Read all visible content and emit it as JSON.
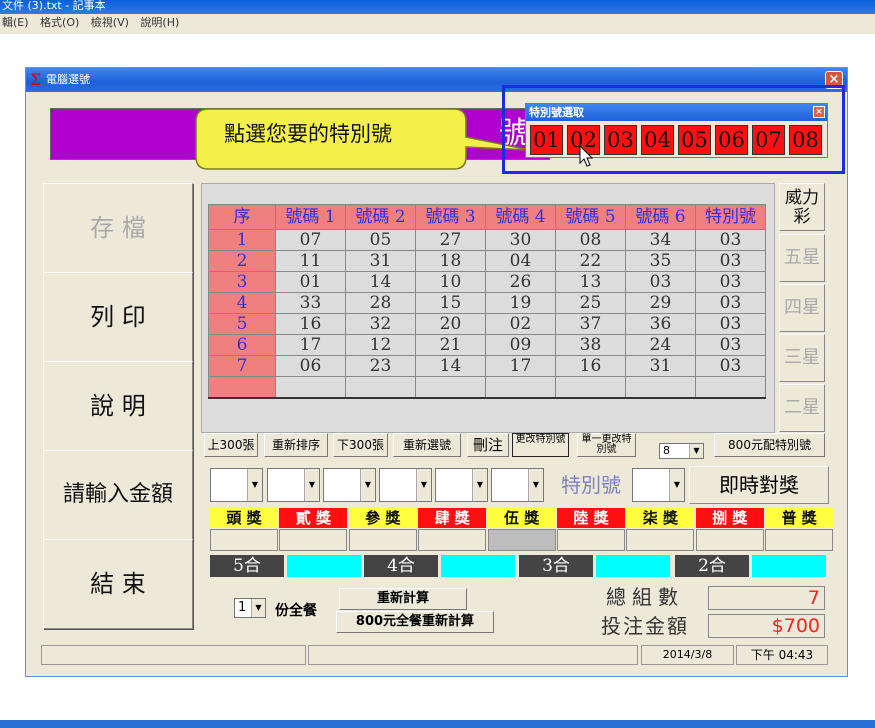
{
  "notepad": {
    "title": "文件 (3).txt - 記事本",
    "menu": [
      "輯(E)",
      "格式(O)",
      "檢視(V)",
      "說明(H)"
    ]
  },
  "dialog": {
    "title": "電腦選號",
    "close": "×",
    "banner_char": "號"
  },
  "left_buttons": {
    "save": "存 檔",
    "print": "列 印",
    "help": "說 明",
    "amount": "請輸入金額",
    "end": "結 束"
  },
  "table": {
    "headers": [
      "序",
      "號碼 1",
      "號碼 2",
      "號碼 3",
      "號碼 4",
      "號碼 5",
      "號碼 6",
      "特別號"
    ],
    "rows": [
      [
        "1",
        "07",
        "05",
        "27",
        "30",
        "08",
        "34",
        "03"
      ],
      [
        "2",
        "11",
        "31",
        "18",
        "04",
        "22",
        "35",
        "03"
      ],
      [
        "3",
        "01",
        "14",
        "10",
        "26",
        "13",
        "03",
        "03"
      ],
      [
        "4",
        "33",
        "28",
        "15",
        "19",
        "25",
        "29",
        "03"
      ],
      [
        "5",
        "16",
        "32",
        "20",
        "02",
        "37",
        "36",
        "03"
      ],
      [
        "6",
        "17",
        "12",
        "21",
        "09",
        "38",
        "24",
        "03"
      ],
      [
        "7",
        "06",
        "23",
        "14",
        "17",
        "16",
        "31",
        "03"
      ]
    ]
  },
  "types": {
    "power": "威力彩",
    "five": "五星",
    "four": "四星",
    "three": "三星",
    "two": "二星"
  },
  "toolbar": {
    "prev300": "上300張",
    "resort": "重新排序",
    "next300": "下300張",
    "reselect": "重新選號",
    "delete": "刪注",
    "change_special": "更改特別號",
    "single_change": "單一更改特別號",
    "count_select": "8",
    "special_800": "800元配特別號"
  },
  "entry": {
    "special_label": "特別號",
    "instant_button": "即時對獎"
  },
  "prizes": [
    {
      "label": "頭 獎",
      "style": "yellow"
    },
    {
      "label": "貳 獎",
      "style": "red"
    },
    {
      "label": "參 獎",
      "style": "yellow"
    },
    {
      "label": "肆 獎",
      "style": "red"
    },
    {
      "label": "伍 獎",
      "style": "yellow"
    },
    {
      "label": "陸 獎",
      "style": "red"
    },
    {
      "label": "柒 獎",
      "style": "yellow"
    },
    {
      "label": "捌 獎",
      "style": "red"
    },
    {
      "label": "普 獎",
      "style": "yellow"
    }
  ],
  "matches": [
    "5合",
    "4合",
    "3合",
    "2合"
  ],
  "bottom": {
    "package_count": "1",
    "package_label": "份全餐",
    "recalc": "重新計算",
    "recalc_800": "800元全餐重新計算",
    "total_label": "總組數",
    "total_value": "7",
    "amount_label": "投注金額",
    "amount_value": "$700"
  },
  "status": {
    "date": "2014/3/8",
    "time": "下午 04:43"
  },
  "special_picker": {
    "title": "特別號選取",
    "close": "×",
    "numbers": [
      "01",
      "02",
      "03",
      "04",
      "05",
      "06",
      "07",
      "08"
    ]
  },
  "callout": {
    "text": "點選您要的特別號"
  },
  "colors": {
    "banner": "#b000d0",
    "header_bg": "#f08080",
    "header_text": "#3030e0",
    "match_box": "#00ffff",
    "amount_text": "#ff2020"
  }
}
